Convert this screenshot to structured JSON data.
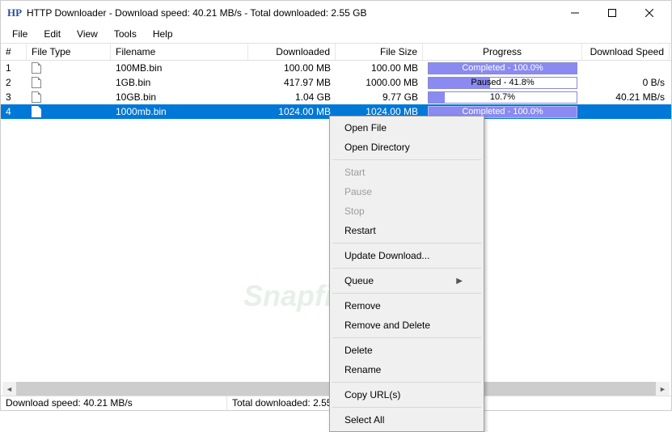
{
  "title": "HTTP Downloader - Download speed:  40.21 MB/s - Total downloaded:  2.55 GB",
  "app_icon_text": "HP",
  "menu": {
    "file": "File",
    "edit": "Edit",
    "view": "View",
    "tools": "Tools",
    "help": "Help"
  },
  "columns": {
    "num": "#",
    "type": "File Type",
    "filename": "Filename",
    "downloaded": "Downloaded",
    "size": "File Size",
    "progress": "Progress",
    "speed": "Download Speed"
  },
  "rows": [
    {
      "num": "1",
      "filename": "100MB.bin",
      "downloaded": "100.00 MB",
      "size": "100.00 MB",
      "progress_label": "Completed - 100.0%",
      "progress_pct": 100,
      "status": "completed",
      "speed": ""
    },
    {
      "num": "2",
      "filename": "1GB.bin",
      "downloaded": "417.97 MB",
      "size": "1000.00 MB",
      "progress_label": "Paused - 41.8%",
      "progress_pct": 41.8,
      "status": "paused",
      "speed": "0 B/s"
    },
    {
      "num": "3",
      "filename": "10GB.bin",
      "downloaded": "1.04 GB",
      "size": "9.77 GB",
      "progress_label": "10.7%",
      "progress_pct": 10.7,
      "status": "running",
      "speed": "40.21 MB/s"
    },
    {
      "num": "4",
      "filename": "1000mb.bin",
      "downloaded": "1024.00 MB",
      "size": "1024.00 MB",
      "progress_label": "Completed - 100.0%",
      "progress_pct": 100,
      "status": "completed",
      "speed": "",
      "selected": true
    }
  ],
  "context_menu": {
    "open_file": "Open File",
    "open_directory": "Open Directory",
    "start": "Start",
    "pause": "Pause",
    "stop": "Stop",
    "restart": "Restart",
    "update": "Update Download...",
    "queue": "Queue",
    "remove": "Remove",
    "remove_delete": "Remove and Delete",
    "delete": "Delete",
    "rename": "Rename",
    "copy_urls": "Copy URL(s)",
    "select_all": "Select All"
  },
  "status": {
    "speed": "Download speed:  40.21 MB/s",
    "total": "Total downloaded:  2.55 GB"
  },
  "watermark": "Snapfiles"
}
